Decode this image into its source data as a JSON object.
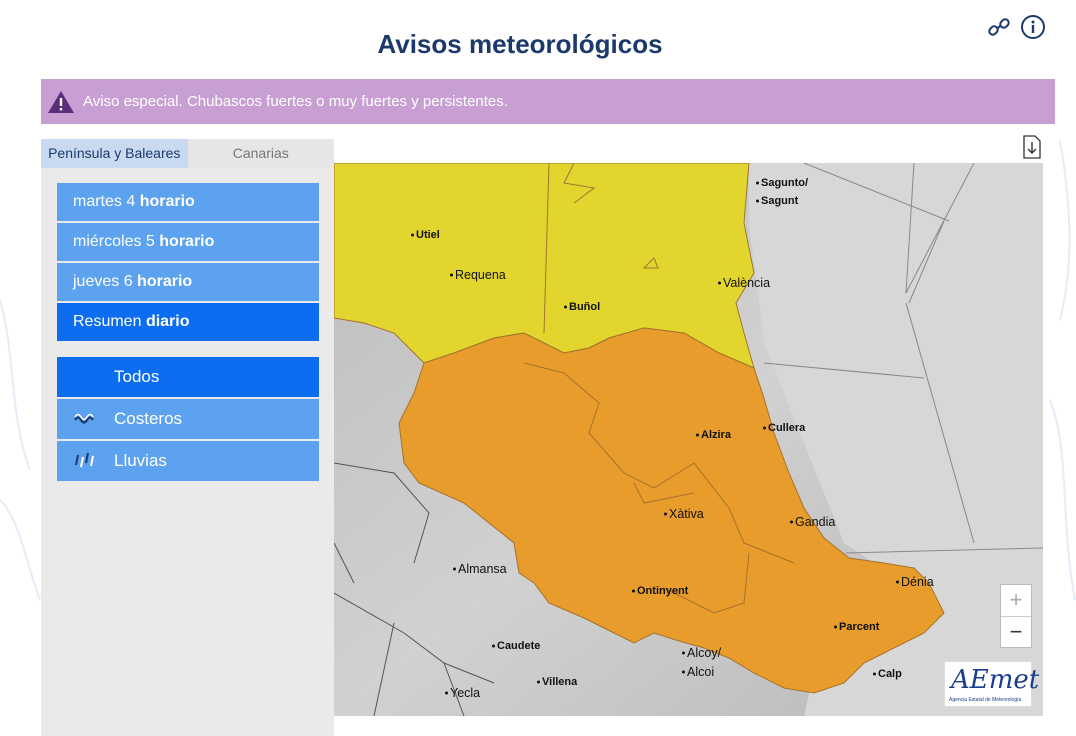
{
  "page": {
    "title": "Avisos meteorológicos"
  },
  "header_icons": [
    {
      "name": "link-icon"
    },
    {
      "name": "info-icon"
    }
  ],
  "banner": {
    "text": "Aviso especial. Chubascos fuertes o muy fuertes y persistentes.",
    "icon": "warning-triangle-icon",
    "color": "#c89fd2"
  },
  "tabs": [
    {
      "label": "Península y Baleares",
      "active": true
    },
    {
      "label": "Canarias",
      "active": false
    }
  ],
  "days": [
    {
      "label": "martes 4",
      "bold": "horario"
    },
    {
      "label": "miércoles 5",
      "bold": "horario"
    },
    {
      "label": "jueves 6",
      "bold": "horario"
    },
    {
      "label": "Resumen",
      "bold": "diario",
      "active": true
    }
  ],
  "types": [
    {
      "label": "Todos",
      "active": true
    },
    {
      "label": "Costeros",
      "icon": "waves-icon"
    },
    {
      "label": "Lluvias",
      "icon": "rain-icon"
    }
  ],
  "map": {
    "warning_colors": {
      "yellow": "#e2d62e",
      "orange": "#e79c2c",
      "base": "#cfcfcf"
    },
    "cities": [
      "Sagunto/",
      "Sagunt",
      "Utiel",
      "Requena",
      "València",
      "Buñol",
      "Alzira",
      "Cullera",
      "Xàtiva",
      "Gandia",
      "Almansa",
      "Ontinyent",
      "Dénia",
      "Parcent",
      "Caudete",
      "Alcoy/",
      "Alcoi",
      "Villena",
      "Calp",
      "Yecla"
    ],
    "zoom_in": "+",
    "zoom_out": "−",
    "logo_text": "AEmet",
    "logo_sub": "Agencia Estatal de Meteorología"
  }
}
